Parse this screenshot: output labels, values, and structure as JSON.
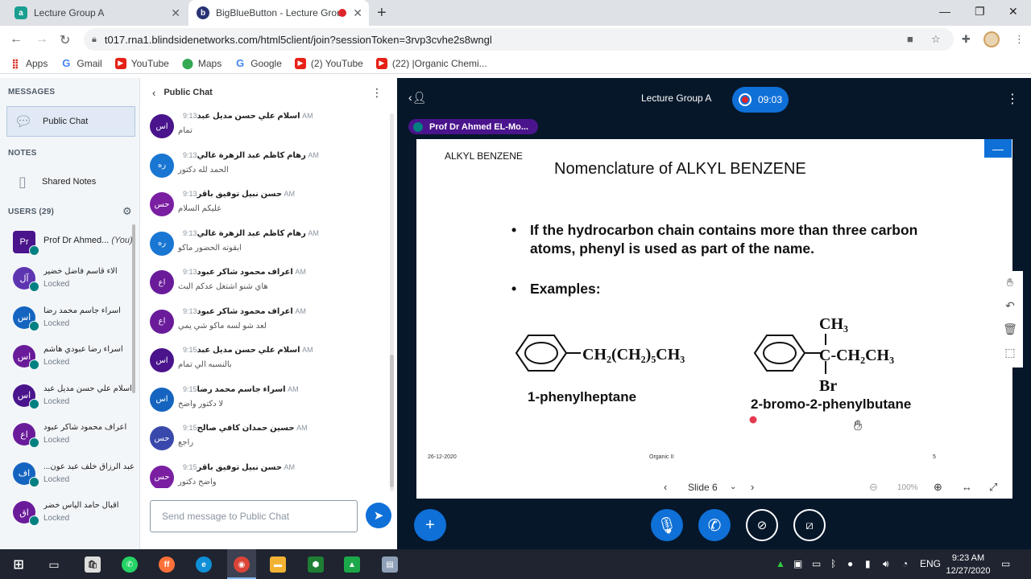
{
  "browser": {
    "tabs": [
      {
        "title": "Lecture Group A"
      },
      {
        "title": "BigBlueButton - Lecture Grou"
      }
    ],
    "url": "t017.rna1.blindsidenetworks.com/html5client/join?sessionToken=3rvp3cvhe2s8wngl",
    "bookmarks": [
      "Apps",
      "Gmail",
      "YouTube",
      "Maps",
      "Google",
      "(2) YouTube",
      "(22) |Organic Chemi..."
    ]
  },
  "sidebar": {
    "messages_title": "MESSAGES",
    "public_chat": "Public Chat",
    "notes_title": "NOTES",
    "shared_notes": "Shared Notes",
    "users_title": "USERS (29)",
    "me": {
      "initials": "Pr",
      "name": "Prof Dr Ahmed...",
      "you": "(You)"
    },
    "users": [
      {
        "initials": "آل",
        "name": "آلاء قاسم فاضل خضير",
        "status": "Locked",
        "color": "#5e35b1"
      },
      {
        "initials": "اس",
        "name": "اسراء جاسم محمد رضا",
        "status": "Locked",
        "color": "#1565c0"
      },
      {
        "initials": "اس",
        "name": "اسراء رضا عبودي هاشم",
        "status": "Locked",
        "color": "#6a1b9a"
      },
      {
        "initials": "اس",
        "name": "اسلام علي حسن مديل عبد",
        "status": "Locked",
        "color": "#4a148c"
      },
      {
        "initials": "اع",
        "name": "اعراف محمود شاكر عبود",
        "status": "Locked",
        "color": "#6a1b9a"
      },
      {
        "initials": "اف",
        "name": "...عبد الرزاق خلف عبد عون",
        "status": "Locked",
        "color": "#1565c0"
      },
      {
        "initials": "اق",
        "name": "اقبال حامد الياس خضر",
        "status": "Locked",
        "color": "#6a1b9a"
      }
    ]
  },
  "chat": {
    "title": "Public Chat",
    "input_placeholder": "Send message to Public Chat",
    "messages": [
      {
        "initials": "اس",
        "name": "اسلام علي حسن مديل عبد",
        "time": "9:13 AM",
        "text": "تمام",
        "color": "#4a148c"
      },
      {
        "initials": "ره",
        "name": "رهام كاظم عبد الزهرة غالي",
        "time": "9:13 AM",
        "text": "الحمد لله دكتور",
        "color": "#1976d2"
      },
      {
        "initials": "حس",
        "name": "حسن نبيل توفيق باقر",
        "time": "9:13 AM",
        "text": "عليكم السلام",
        "color": "#7b1fa2"
      },
      {
        "initials": "ره",
        "name": "رهام كاظم عبد الزهرة غالي",
        "time": "9:13 AM",
        "text": "ابقوته الحضور ماكو",
        "color": "#1976d2"
      },
      {
        "initials": "اع",
        "name": "اعراف محمود شاكر عبود",
        "time": "9:13 AM",
        "text": "هاي شنو اشتغل عدكم البث",
        "color": "#6a1b9a"
      },
      {
        "initials": "اع",
        "name": "اعراف محمود شاكر عبود",
        "time": "9:13 AM",
        "text": "لعد شو لسه ماكو شي يمي",
        "color": "#6a1b9a"
      },
      {
        "initials": "اس",
        "name": "اسلام علي حسن مديل عبد",
        "time": "9:15 AM",
        "text": "بالنسبه الي تمام",
        "color": "#4a148c"
      },
      {
        "initials": "اس",
        "name": "اسراء جاسم محمد رضا",
        "time": "9:15 AM",
        "text": "لا دكتور واضح",
        "color": "#1565c0"
      },
      {
        "initials": "حس",
        "name": "حسين حمدان كافي صالح",
        "time": "9:15 AM",
        "text": "راجع",
        "color": "#3949ab"
      },
      {
        "initials": "حس",
        "name": "حسن نبيل توفيق باقر",
        "time": "9:15 AM",
        "text": "واضح دكتور",
        "color": "#7b1fa2"
      }
    ]
  },
  "main": {
    "meeting_title": "Lecture Group A",
    "recording_time": "09:03",
    "presenter": "Prof Dr Ahmed EL-Mo...",
    "slide_nav": {
      "current": "Slide 6",
      "zoom": "100%"
    }
  },
  "slide": {
    "tag": "ALKYL BENZENE",
    "title": "Nomenclature of ALKYL BENZENE",
    "bullets": [
      "If the hydrocarbon chain contains more than three carbon atoms, phenyl is used as part of the name.",
      "Examples:"
    ],
    "compound1": {
      "formula": "CH₂(CH₂)₅CH₃",
      "name": "1-phenylheptane"
    },
    "compound2": {
      "top": "CH₃",
      "formula": "C-CH₂CH₃",
      "bottom": "Br",
      "name": "2-bromo-2-phenylbutane"
    },
    "footer": {
      "date": "26-12-2020",
      "course": "Organic II",
      "page": "5"
    }
  },
  "taskbar": {
    "lang": "ENG",
    "time": "9:23 AM",
    "date": "12/27/2020"
  }
}
